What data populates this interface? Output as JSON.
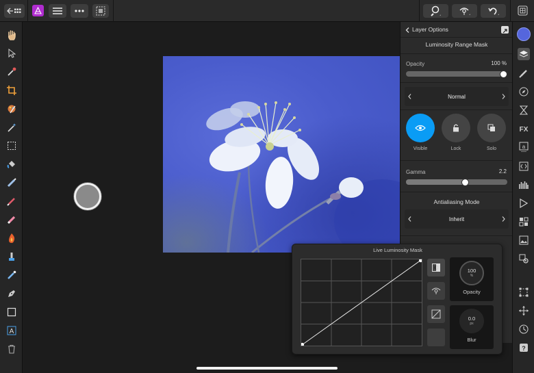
{
  "topbar": {
    "icons": [
      "back-grid-icon",
      "affinity-photo-logo",
      "hamburger-menu-icon",
      "more-icon",
      "selection-icon",
      "zoom-icon",
      "view-mode-icon",
      "undo-icon",
      "export-icon"
    ]
  },
  "left_tools": [
    "hand-icon",
    "move-icon",
    "color-picker-icon",
    "crop-icon",
    "paint-icon",
    "magic-wand-icon",
    "marquee-icon",
    "flood-fill-icon",
    "smudge-icon",
    "brush-icon",
    "eraser-icon",
    "burn-icon",
    "clone-icon",
    "dodge-icon",
    "pen-icon",
    "rectangle-icon",
    "text-icon",
    "trash-icon"
  ],
  "panel": {
    "back_label": "Layer Options",
    "title": "Luminosity Range Mask",
    "opacity_label": "Opacity",
    "opacity_value": "100 %",
    "opacity_fraction": 1.0,
    "blend_mode": "Normal",
    "visible_label": "Visible",
    "lock_label": "Lock",
    "solo_label": "Solo",
    "gamma_label": "Gamma",
    "gamma_value": "2.2",
    "gamma_fraction": 0.59,
    "antialias_label": "Antialiasing Mode",
    "antialias_value": "Inherit",
    "accent_color": "#0a9cf5"
  },
  "studio_icons": [
    "color-icon",
    "layers-icon",
    "brushes-icon",
    "navigator-icon",
    "history-icon",
    "fx-icon",
    "character-icon",
    "transform-icon",
    "histogram-icon",
    "macro-icon",
    "channels-icon",
    "stock-icon",
    "settings-icon",
    "snapping-icon",
    "constraints-icon",
    "clock-icon",
    "help-icon"
  ],
  "lum_mask": {
    "title": "Live Luminosity Mask",
    "opacity_value": "100",
    "opacity_unit": "%",
    "opacity_label": "Opacity",
    "blur_value": "0.0",
    "blur_unit": "px",
    "blur_label": "Blur"
  }
}
